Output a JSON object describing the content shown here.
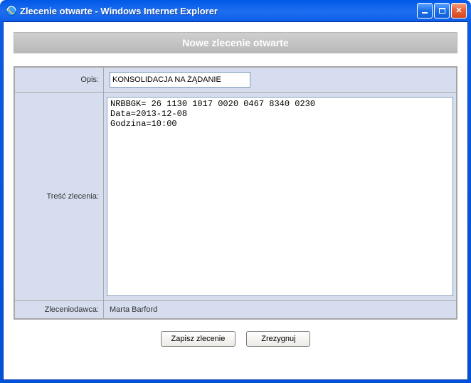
{
  "window": {
    "title": "Zlecenie otwarte - Windows Internet Explorer"
  },
  "page": {
    "heading": "Nowe zlecenie otwarte"
  },
  "form": {
    "opis_label": "Opis:",
    "opis_value": "KONSOLIDACJA NA ŻĄDANIE",
    "tresc_label": "Treść zlecenia:",
    "tresc_value": "NRBBGK= 26 1130 1017 0020 0467 8340 0230\nData=2013-12-08\nGodzina=10:00",
    "zleceniodawca_label": "Zleceniodawca:",
    "zleceniodawca_value": "Marta Barford"
  },
  "buttons": {
    "save": "Zapisz zlecenie",
    "cancel": "Zrezygnuj"
  }
}
